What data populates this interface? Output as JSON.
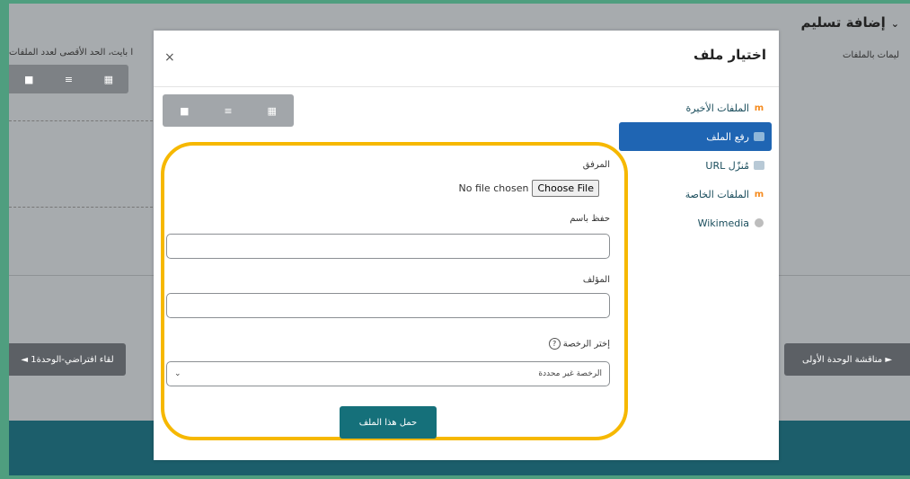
{
  "background": {
    "heading": "إضافة تسليم",
    "heading_chevron": "⌄",
    "subtext": "ليمات بالملفات",
    "limit_text": "ا بايت، الحد الأقصى لعدد الملفات",
    "toolbar_icons": [
      "folder-icon",
      "list-icon",
      "grid-icon"
    ],
    "nav_left": "لقاء افتراضي-الوحدة1 ◄",
    "nav_right": "► مناقشة الوحدة الأولى"
  },
  "modal": {
    "title": "اختيار ملف",
    "close_glyph": "×",
    "view_icons": [
      "folder-icon",
      "list-icon",
      "grid-icon"
    ],
    "sidebar": [
      {
        "label": "الملفات الأخيرة",
        "icon": "moodle-icon",
        "active": false
      },
      {
        "label": "رفع الملف",
        "icon": "upload-icon",
        "active": true
      },
      {
        "label": "مُنزّل URL",
        "icon": "url-downloader-icon",
        "active": false
      },
      {
        "label": "الملفات الخاصة",
        "icon": "moodle-icon",
        "active": false
      },
      {
        "label": "Wikimedia",
        "icon": "wikimedia-icon",
        "active": false
      }
    ],
    "form": {
      "attachment_label": "المرفق",
      "no_file_text": "No file chosen",
      "choose_file_label": "Choose File",
      "save_as_label": "حفظ باسم",
      "save_as_value": "",
      "author_label": "المؤلف",
      "author_value": "",
      "license_label": "إختر الرخصة",
      "license_value": "الرخصة غير محددة",
      "upload_button": "حمل هذا الملف"
    }
  },
  "colors": {
    "accent": "#1f65b3",
    "button": "#15707a",
    "highlight_ring": "#f6b800",
    "outer_frame": "#4f9e7f",
    "footer_band": "#1c5e6b"
  }
}
